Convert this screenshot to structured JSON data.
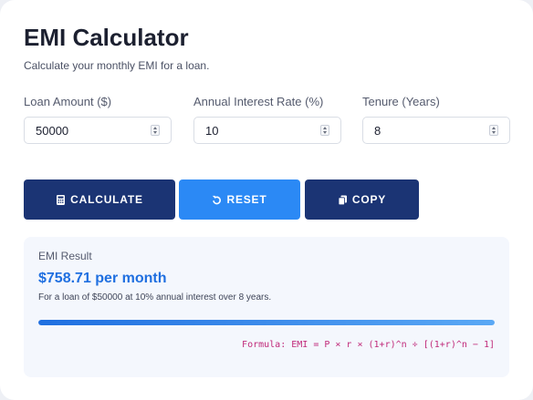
{
  "header": {
    "title": "EMI Calculator",
    "subtitle": "Calculate your monthly EMI for a loan."
  },
  "fields": {
    "loan_amount": {
      "label": "Loan Amount ($)",
      "value": "50000"
    },
    "interest_rate": {
      "label": "Annual Interest Rate (%)",
      "value": "10"
    },
    "tenure": {
      "label": "Tenure (Years)",
      "value": "8"
    }
  },
  "actions": {
    "calculate": {
      "label": "CALCULATE",
      "icon": "calculator-icon",
      "color": "#1b3474"
    },
    "reset": {
      "label": "RESET",
      "icon": "undo-icon",
      "color": "#2b89f5"
    },
    "copy": {
      "label": "COPY",
      "icon": "copy-icon",
      "color": "#1b3474"
    }
  },
  "result": {
    "label": "EMI Result",
    "amount": "$758.71 per month",
    "description": "For a loan of $50000 at 10% annual interest over 8 years.",
    "progress": 1.0,
    "formula": "Formula: EMI = P × r × (1+r)^n ÷ [(1+r)^n − 1]",
    "accent_color": "#1f6fe0",
    "formula_color": "#c02a7a"
  }
}
